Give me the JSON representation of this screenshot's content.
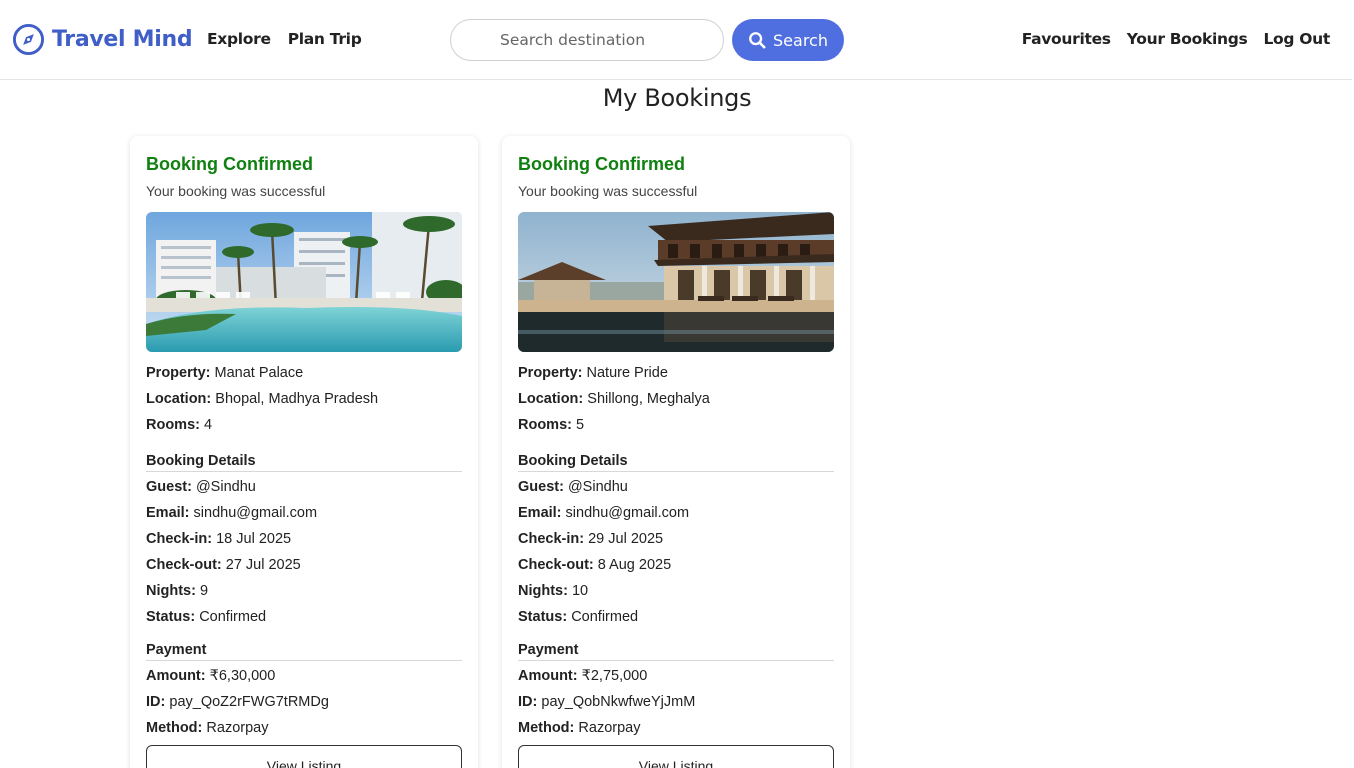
{
  "brand": {
    "name": "Travel Mind"
  },
  "nav": {
    "left": [
      "Explore",
      "Plan Trip"
    ],
    "right": [
      "Favourites",
      "Your Bookings",
      "Log Out"
    ]
  },
  "search": {
    "placeholder": "Search destination",
    "button_label": "Search"
  },
  "page_title": "My Bookings",
  "labels": {
    "property": "Property:",
    "location": "Location:",
    "rooms": "Rooms:",
    "booking_details": "Booking Details",
    "guest": "Guest:",
    "email": "Email:",
    "checkin": "Check-in:",
    "checkout": "Check-out:",
    "nights": "Nights:",
    "status": "Status:",
    "payment": "Payment",
    "amount": "Amount:",
    "id": "ID:",
    "method": "Method:"
  },
  "bookings": [
    {
      "heading": "Booking Confirmed",
      "subtitle": "Your booking was successful",
      "property": "Manat Palace",
      "location": "Bhopal, Madhya Pradesh",
      "rooms": "4",
      "guest": "@Sindhu",
      "email": "sindhu@gmail.com",
      "checkin": "18 Jul 2025",
      "checkout": "27 Jul 2025",
      "nights": "9",
      "status": "Confirmed",
      "amount": "₹6,30,000",
      "payment_id": "pay_QoZ2rFWG7tRMDg",
      "method": "Razorpay",
      "button_label": "View Listing"
    },
    {
      "heading": "Booking Confirmed",
      "subtitle": "Your booking was successful",
      "property": "Nature Pride",
      "location": "Shillong, Meghalya",
      "rooms": "5",
      "guest": "@Sindhu",
      "email": "sindhu@gmail.com",
      "checkin": "29 Jul 2025",
      "checkout": "8 Aug 2025",
      "nights": "10",
      "status": "Confirmed",
      "amount": "₹2,75,000",
      "payment_id": "pay_QobNkwfweYjJmM",
      "method": "Razorpay",
      "button_label": "View Listing"
    }
  ],
  "colors": {
    "brand": "#3f5ec8",
    "search_button": "#4f6ee0",
    "confirmed_green": "#108010"
  },
  "icons": [
    "compass-icon",
    "search-icon"
  ]
}
